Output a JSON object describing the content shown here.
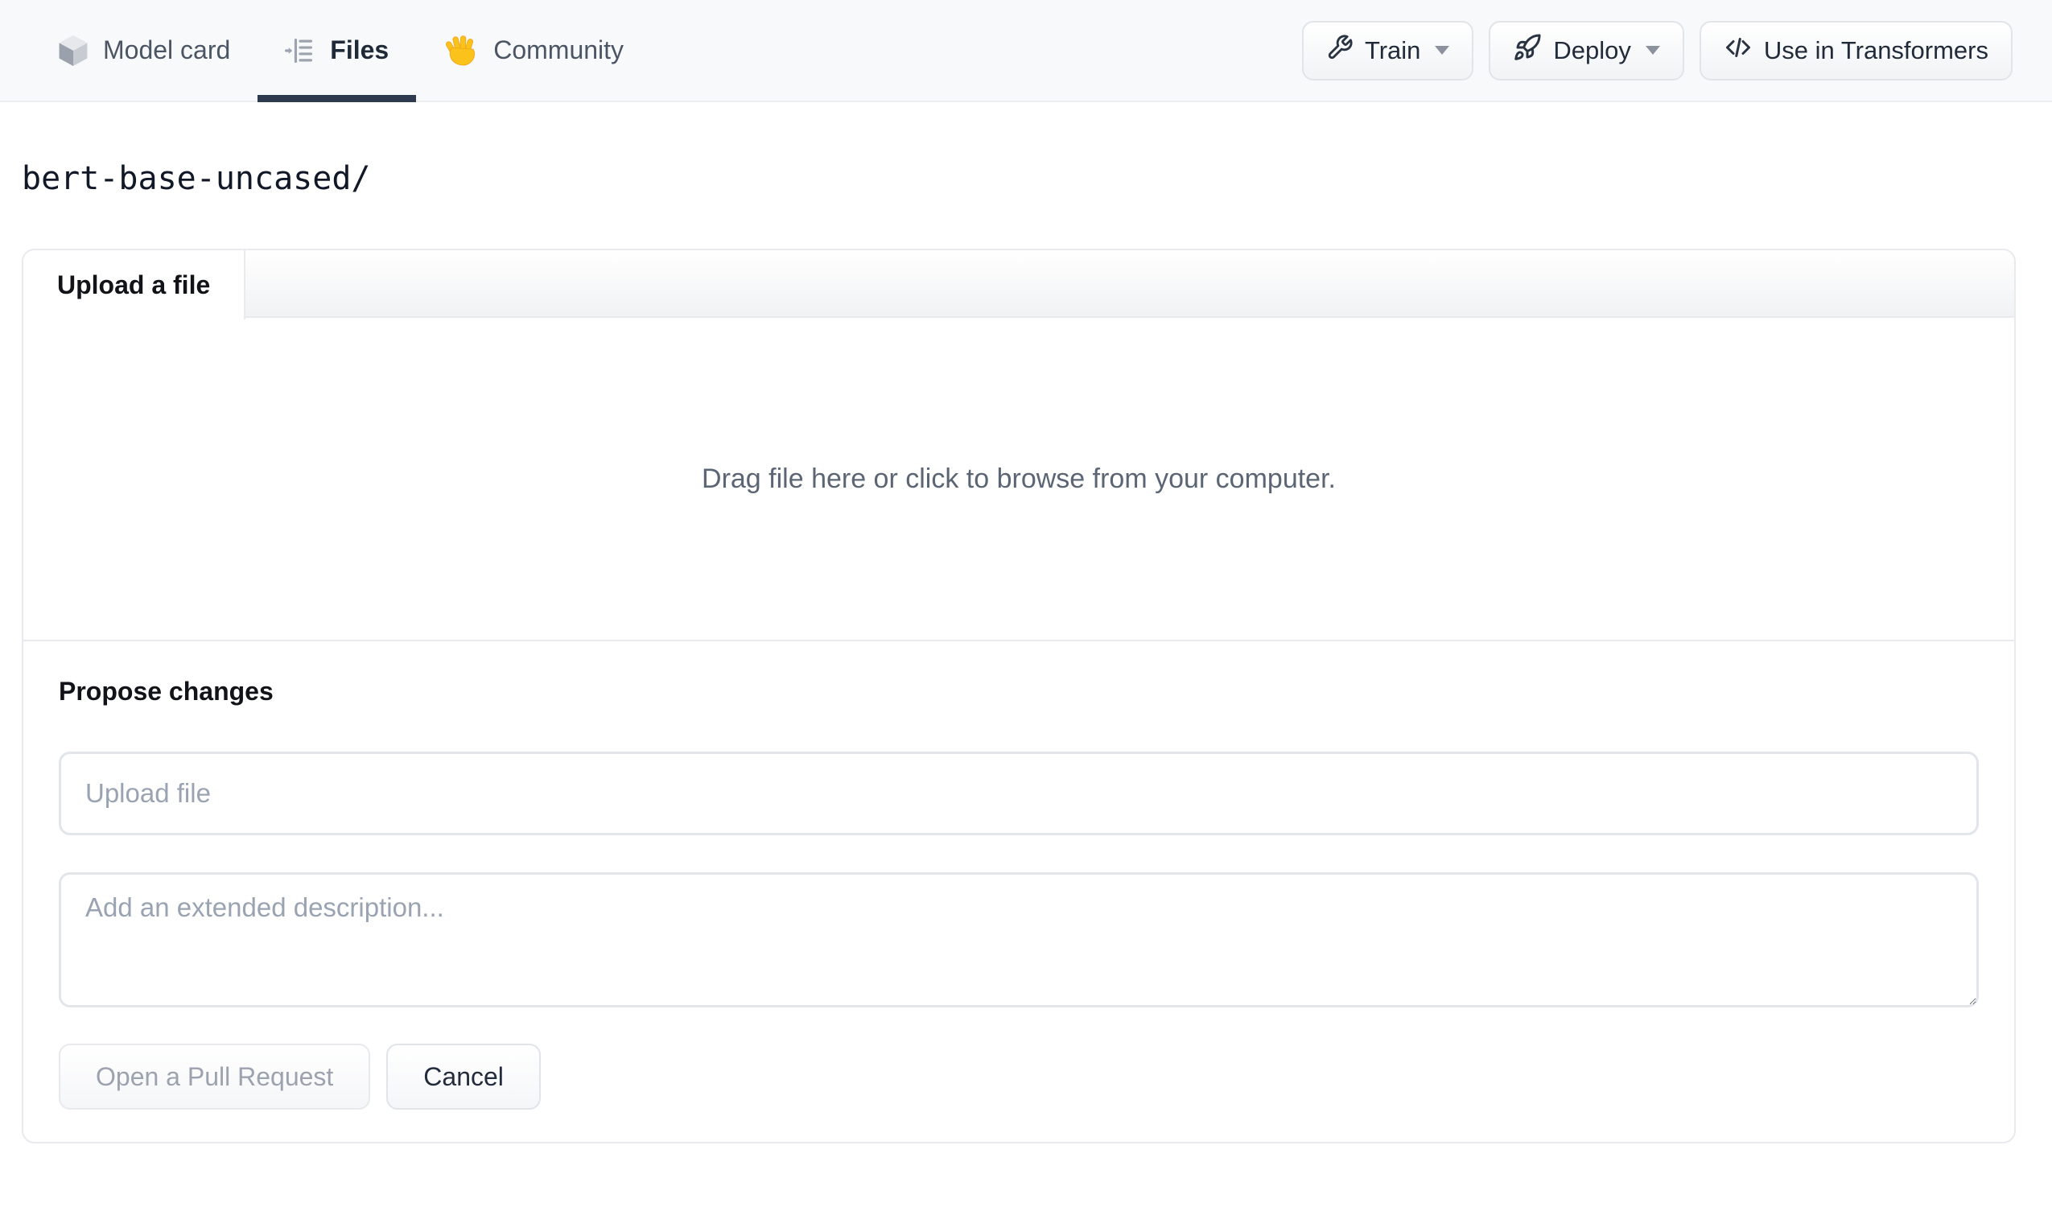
{
  "nav": {
    "tabs": [
      {
        "label": "Model card",
        "icon": "model-cube-icon",
        "active": false
      },
      {
        "label": "Files",
        "icon": "files-list-icon",
        "active": true
      },
      {
        "label": "Community",
        "icon": "waving-hand-icon",
        "active": false
      }
    ],
    "actions": [
      {
        "label": "Train",
        "icon": "wrench-icon",
        "dropdown": true
      },
      {
        "label": "Deploy",
        "icon": "rocket-icon",
        "dropdown": true
      },
      {
        "label": "Use in Transformers",
        "icon": "code-icon",
        "dropdown": false
      }
    ]
  },
  "path": "bert-base-uncased/",
  "upload_panel": {
    "tab_label": "Upload a file",
    "dropzone_text": "Drag file here or click to browse from your computer.",
    "propose": {
      "heading": "Propose changes",
      "filename_placeholder": "Upload file",
      "description_placeholder": "Add an extended description...",
      "submit_label": "Open a Pull Request",
      "submit_disabled": true,
      "cancel_label": "Cancel"
    }
  },
  "colors": {
    "navbar_bg": "#f8f9fb",
    "active_tab_underline": "#2e3a4e",
    "panel_border": "#e8eaee",
    "input_border": "#e2e5ea",
    "muted_text": "#5c6574",
    "placeholder_text": "#9aa3b2",
    "disabled_text": "#9ca3af",
    "hand_emoji_yellow": "#fcc21c"
  }
}
